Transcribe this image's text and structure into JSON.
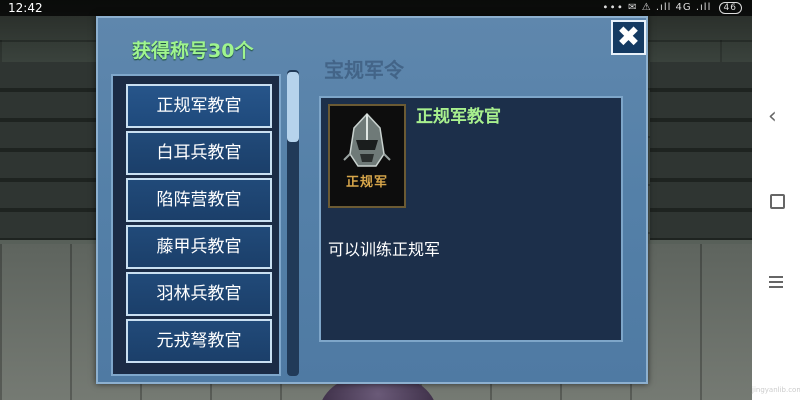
{
  "status_bar": {
    "time": "12:42",
    "icons_text": "∙∙∙ ✉ ⚠ .ıll 4G .ıll",
    "battery": "46"
  },
  "dialog": {
    "title": "获得称号30个",
    "faded_bg_text": "宝规军令",
    "close_symbol": "✖"
  },
  "title_list": {
    "items": [
      {
        "label": "正规军教官",
        "selected": true
      },
      {
        "label": "白耳兵教官",
        "selected": false
      },
      {
        "label": "陷阵营教官",
        "selected": false
      },
      {
        "label": "藤甲兵教官",
        "selected": false
      },
      {
        "label": "羽林兵教官",
        "selected": false
      },
      {
        "label": "元戎弩教官",
        "selected": false
      }
    ]
  },
  "detail": {
    "name": "正规军教官",
    "portrait_label": "正规军",
    "portrait_icon": "helmet-icon",
    "description": "可以训练正规军"
  },
  "nav_bar": {
    "back_icon": "back-icon",
    "home_icon": "home-icon",
    "menu_icon": "menu-icon"
  },
  "watermark": "jingyanlib.com",
  "colors": {
    "title_green": "#9ff48e",
    "panel_dark": "#1c2f4a",
    "dialog_blue": "#5480a8",
    "list_button": "#214a79"
  }
}
